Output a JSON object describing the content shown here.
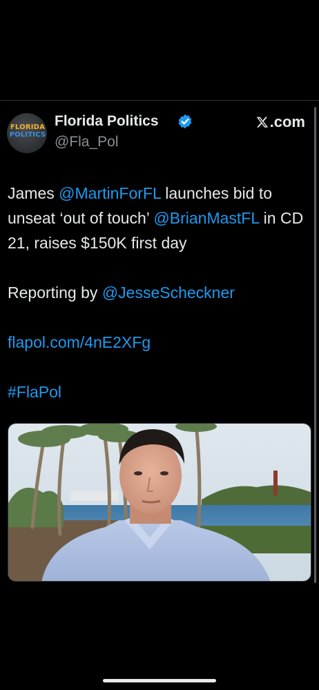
{
  "header": {
    "display_name": "Florida Politics",
    "handle": "@Fla_Pol",
    "source_label": ".com",
    "avatar_logo_line1": "FLORIDA",
    "avatar_logo_line2": "POLITICS"
  },
  "tweet": {
    "line1_prefix": "James ",
    "line1_mention": "@MartinForFL",
    "line1_suffix": " launches bid to unseat ‘out of touch’ ",
    "line1_mention2": "@BrianMastFL",
    "line1_end": " in CD 21, raises $150K first day",
    "reporting_prefix": "Reporting by ",
    "reporting_mention": "@JesseScheckner",
    "link": "flapol.com/4nE2XFg",
    "hashtag": "#FlaPol"
  },
  "colors": {
    "background": "#000000",
    "text": "#e7e9ea",
    "secondary_text": "#8b9095",
    "link": "#1d9bf0",
    "verified": "#1d9bf0"
  },
  "icons": {
    "verified": "verified-badge-icon",
    "x_logo": "x-logo-icon"
  }
}
